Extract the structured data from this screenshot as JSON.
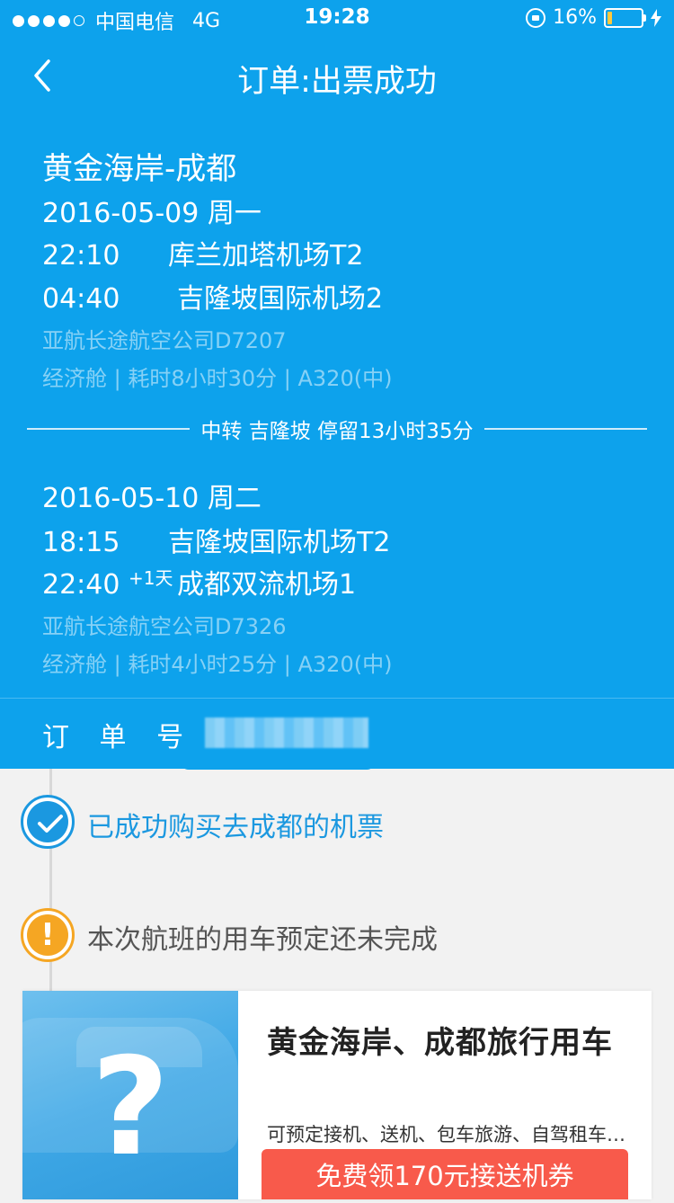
{
  "status_bar": {
    "carrier": "中国电信",
    "network": "4G",
    "time": "19:28",
    "battery_percent": "16%",
    "battery_level": 0.16,
    "signal_bars": 4
  },
  "navbar": {
    "title": "订单:出票成功"
  },
  "trip": {
    "route": "黄金海岸-成都",
    "segment1": {
      "date": "2016-05-09 周一",
      "dep_time": "22:10",
      "dep_airport": "库兰加塔机场T2",
      "arr_time": "04:40",
      "arr_airport": "吉隆坡国际机场2",
      "airline_flight": "亚航长途航空公司D7207",
      "details": "经济舱 | 耗时8小时30分 | A320(中)"
    },
    "transfer": "中转 吉隆坡 停留13小时35分",
    "segment2": {
      "date": "2016-05-10 周二",
      "dep_time": "18:15",
      "dep_airport": "吉隆坡国际机场T2",
      "arr_time": "22:40",
      "arr_plus_day": "+1天",
      "arr_airport": "成都双流机场1",
      "airline_flight": "亚航长途航空公司D7326",
      "details": "经济舱 | 耗时4小时25分 | A320(中)"
    }
  },
  "order": {
    "label": "订 单 号"
  },
  "timeline": {
    "success_text": "已成功购买去成都的机票",
    "warning_text": "本次航班的用车预定还未完成"
  },
  "promo_card": {
    "image_mark": "?",
    "title": "黄金海岸、成都旅行用车",
    "description": "可预定接机、送机、包车旅游、自驾租车等服务",
    "button_label": "免费领170元接送机券"
  },
  "colors": {
    "header_bg": "#0da2ec",
    "success": "#1b98e0",
    "warning": "#f5a623",
    "button": "#f85a4b"
  },
  "icons": {
    "back": "chevron-left-icon",
    "success": "check-circle-icon",
    "warning": "exclamation-circle-icon"
  }
}
